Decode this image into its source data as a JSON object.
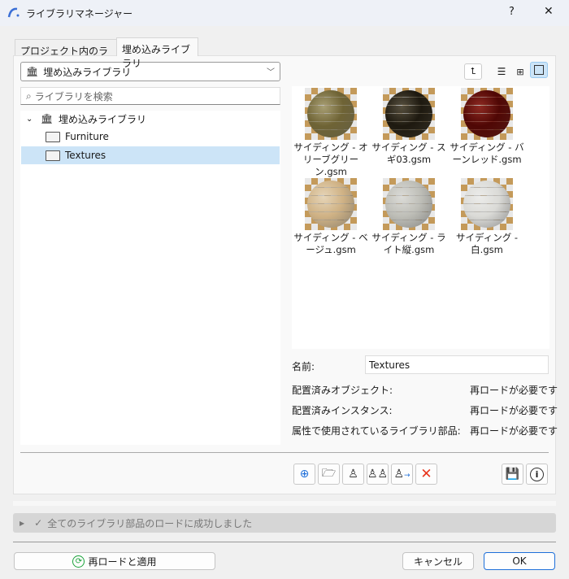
{
  "window": {
    "title": "ライブラリマネージャー",
    "help": "?",
    "close": "✕"
  },
  "tabs": [
    {
      "label": "プロジェクト内のライブラリ"
    },
    {
      "label": "埋め込みライブラリ"
    }
  ],
  "library_select": {
    "value": "埋め込みライブラリ"
  },
  "search": {
    "placeholder": "ライブラリを検索"
  },
  "tree": {
    "root": "埋め込みライブラリ",
    "children": [
      {
        "label": "Furniture"
      },
      {
        "label": "Textures",
        "selected": true
      }
    ]
  },
  "items": [
    {
      "label": "サイディング - オリーブグリーン.gsm",
      "color": "#a89f74"
    },
    {
      "label": "サイディング - スギ03.gsm",
      "color": "#57503f"
    },
    {
      "label": "サイディング - バーンレッド.gsm",
      "color": "#8e2a22"
    },
    {
      "label": "サイディング - ベージュ.gsm",
      "color": "#e6d5b8"
    },
    {
      "label": "サイディング - ライト縦.gsm",
      "color": "#dcdcd8"
    },
    {
      "label": "サイディング - 白.gsm",
      "color": "#ececea"
    }
  ],
  "details": {
    "name_label": "名前:",
    "name_value": "Textures",
    "rows": [
      {
        "label": "配置済みオブジェクト:",
        "value": "再ロードが必要です"
      },
      {
        "label": "配置済みインスタンス:",
        "value": "再ロードが必要です"
      },
      {
        "label": "属性で使用されているライブラリ部品:",
        "value": "再ロードが必要です"
      }
    ]
  },
  "status": {
    "text": "全てのライブラリ部品のロードに成功しました"
  },
  "buttons": {
    "reload": "再ロードと適用",
    "cancel": "キャンセル",
    "ok": "OK"
  }
}
